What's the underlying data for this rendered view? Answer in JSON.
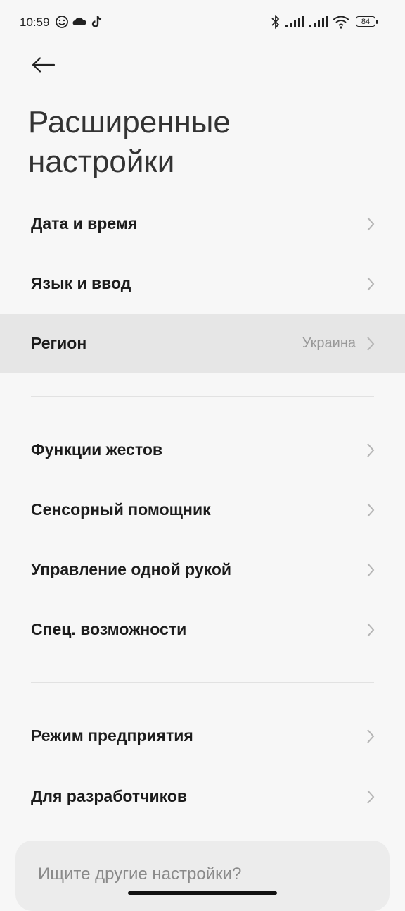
{
  "status_bar": {
    "time": "10:59",
    "battery": "84",
    "icons": [
      "emoji-icon",
      "cloud-icon",
      "tiktok-icon",
      "bluetooth-icon",
      "signal-icon",
      "signal-icon",
      "wifi-icon",
      "battery-icon"
    ]
  },
  "header": {
    "back_icon": "arrow-left-icon",
    "title_line1": "Расширенные",
    "title_line2": "настройки"
  },
  "sections": [
    {
      "items": [
        {
          "label": "Дата и время"
        },
        {
          "label": "Язык и ввод"
        },
        {
          "label": "Регион",
          "value": "Украина"
        }
      ]
    },
    {
      "items": [
        {
          "label": "Функции жестов"
        },
        {
          "label": "Сенсорный помощник"
        },
        {
          "label": "Управление одной рукой"
        },
        {
          "label": "Спец. возможности"
        }
      ]
    },
    {
      "items": [
        {
          "label": "Режим предприятия"
        },
        {
          "label": "Для разработчиков"
        }
      ]
    }
  ],
  "search_card": {
    "text": "Ищите другие настройки?"
  },
  "colors": {
    "background": "#f7f7f7",
    "highlight_row": "#e6e6e6",
    "secondary_text": "#999999"
  }
}
